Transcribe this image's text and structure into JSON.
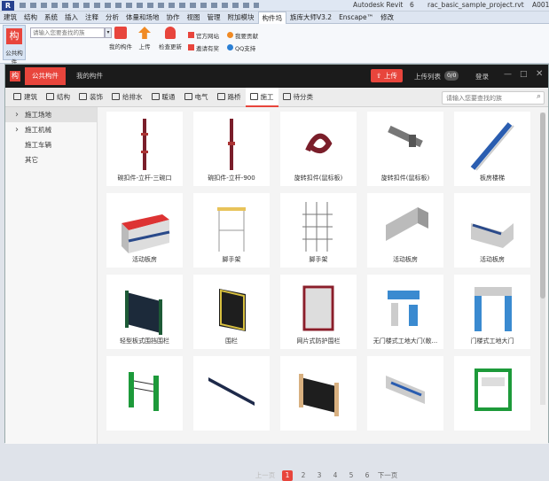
{
  "titlebar": {
    "title": "Autodesk Revit",
    "doc_num": "6",
    "file": "rac_basic_sample_project.rvt",
    "sheet": "A001"
  },
  "ribbon": {
    "tabs": [
      "建筑",
      "结构",
      "系统",
      "插入",
      "注释",
      "分析",
      "体量和场地",
      "协作",
      "视图",
      "管理",
      "附加模块",
      "构件坞",
      "族库大师V3.2",
      "Enscape™",
      "修改"
    ],
    "active": "构件坞",
    "logo_label": "公共构件",
    "search_placeholder": "请输入您要查找的族",
    "buttons": [
      "我的构件",
      "上传",
      "检查更新"
    ],
    "links": [
      "官方网站",
      "我要贡献",
      "邀请有奖",
      "QQ支持"
    ]
  },
  "app": {
    "tabs": [
      "公共构件",
      "我的构件"
    ],
    "upload": "上传",
    "upload_list": "上传列表",
    "upload_count": "0/0",
    "login": "登录",
    "categories": [
      "建筑",
      "结构",
      "装饰",
      "给排水",
      "暖通",
      "电气",
      "路桥",
      "施工",
      "待分类"
    ],
    "active_category": "施工",
    "search_placeholder": "请输入您要查找的族",
    "sidebar": [
      {
        "label": "施工场地",
        "arrow": "›",
        "selected": true
      },
      {
        "label": "施工机械",
        "arrow": "›",
        "selected": false
      },
      {
        "label": "施工车辆",
        "arrow": "",
        "selected": false
      },
      {
        "label": "其它",
        "arrow": "",
        "selected": false
      }
    ],
    "cards": [
      "碗扣件-立杆-三碗口",
      "碗扣件-立杆-900",
      "旋转扣件(鼠标板)",
      "旋转扣件(鼠标板)",
      "板房楼梯",
      "活动板房",
      "脚手架",
      "脚手架",
      "活动板房",
      "活动板房",
      "轻型板式围挡围栏",
      "围栏",
      "网片式防护围栏",
      "无门楼式工地大门(敞...",
      "门楼式工地大门",
      "",
      "",
      "",
      "",
      ""
    ],
    "pagination": {
      "prev": "上一页",
      "pages": [
        "1",
        "2",
        "3",
        "4",
        "5",
        "6"
      ],
      "current": "1",
      "next": "下一页"
    }
  },
  "colors": {
    "accent": "#e8453c",
    "dark_header": "#1b1b1b"
  }
}
